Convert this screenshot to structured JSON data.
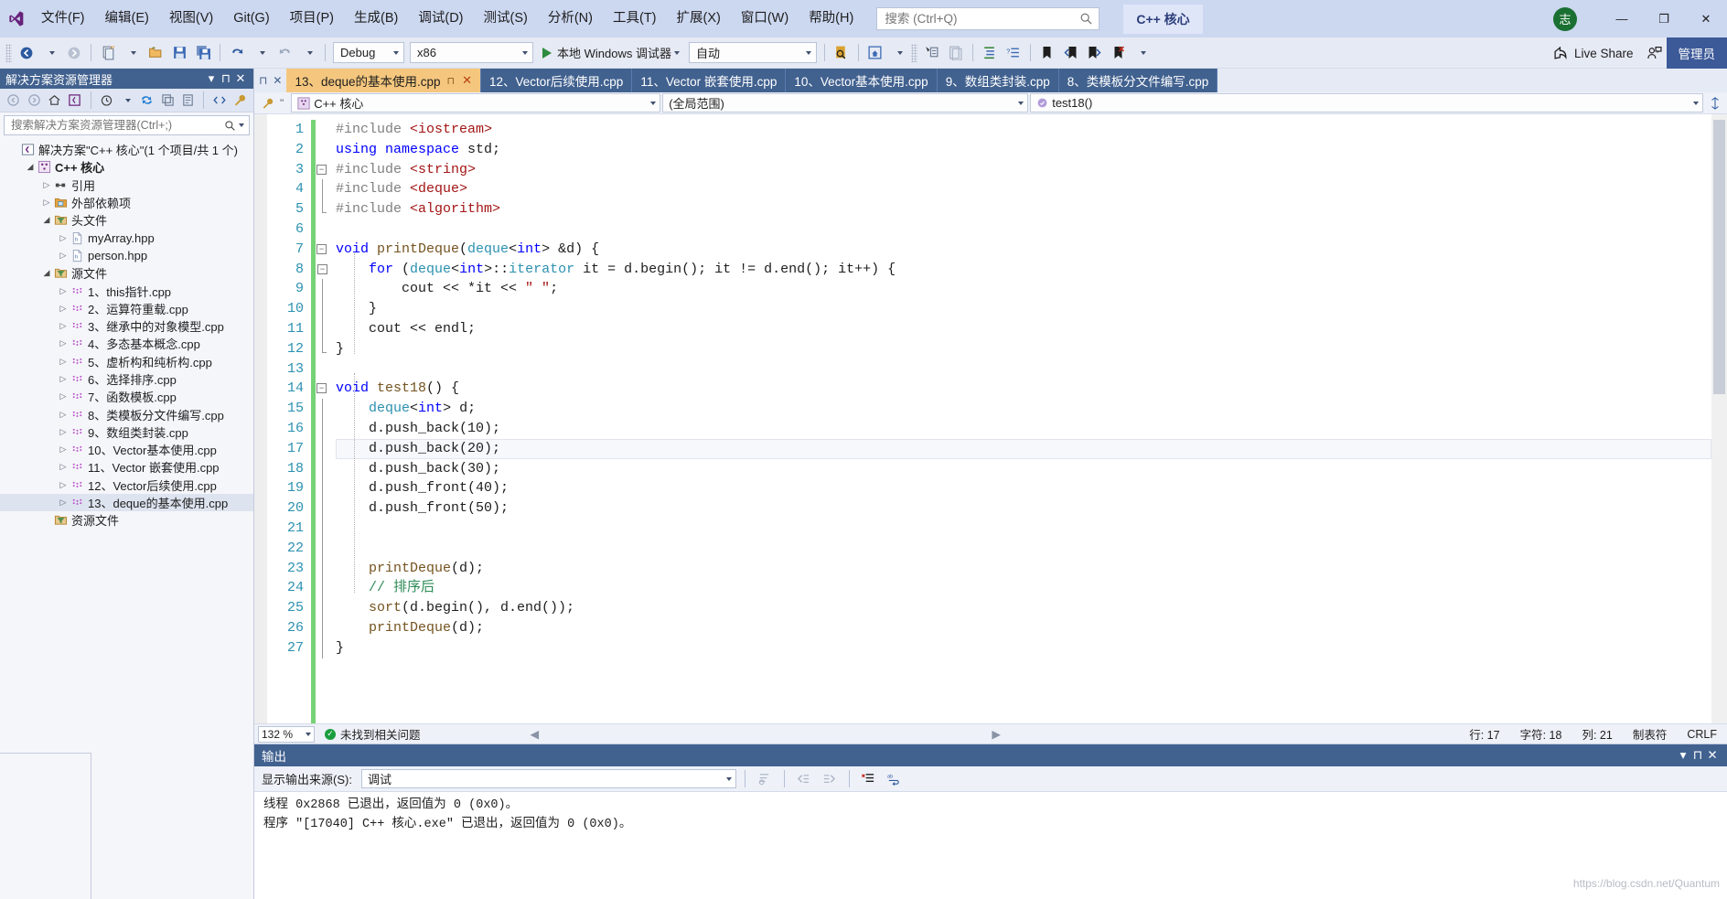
{
  "titlebar": {
    "menu": [
      "文件(F)",
      "编辑(E)",
      "视图(V)",
      "Git(G)",
      "项目(P)",
      "生成(B)",
      "调试(D)",
      "测试(S)",
      "分析(N)",
      "工具(T)",
      "扩展(X)",
      "窗口(W)",
      "帮助(H)"
    ],
    "search_placeholder": "搜索 (Ctrl+Q)",
    "project_badge": "C++ 核心",
    "avatar_text": "志",
    "minimize": "—",
    "maximize": "❐",
    "close": "✕"
  },
  "toolbar": {
    "config": "Debug",
    "platform": "x86",
    "run_label": "本地 Windows 调试器",
    "attach": "自动",
    "live_share": "Live Share",
    "admin": "管理员"
  },
  "solution_explorer": {
    "title": "解决方案资源管理器",
    "search_placeholder": "搜索解决方案资源管理器(Ctrl+;)",
    "tree": [
      {
        "label": "解决方案\"C++ 核心\"(1 个项目/共 1 个)",
        "depth": 0,
        "arrow": "none",
        "icon": "solution-icon",
        "bold": false
      },
      {
        "label": "C++ 核心",
        "depth": 1,
        "arrow": "open",
        "icon": "project-icon",
        "bold": true
      },
      {
        "label": "引用",
        "depth": 2,
        "arrow": "closed",
        "icon": "references-icon",
        "bold": false
      },
      {
        "label": "外部依赖项",
        "depth": 2,
        "arrow": "closed",
        "icon": "folder-ext-icon",
        "bold": false
      },
      {
        "label": "头文件",
        "depth": 2,
        "arrow": "open",
        "icon": "filter-folder-icon",
        "bold": false
      },
      {
        "label": "myArray.hpp",
        "depth": 3,
        "arrow": "closed",
        "icon": "header-file-icon",
        "bold": false
      },
      {
        "label": "person.hpp",
        "depth": 3,
        "arrow": "closed",
        "icon": "header-file-icon",
        "bold": false
      },
      {
        "label": "源文件",
        "depth": 2,
        "arrow": "open",
        "icon": "filter-folder-icon",
        "bold": false
      },
      {
        "label": "1、this指针.cpp",
        "depth": 3,
        "arrow": "closed",
        "icon": "cpp-file-icon",
        "bold": false
      },
      {
        "label": "2、运算符重载.cpp",
        "depth": 3,
        "arrow": "closed",
        "icon": "cpp-file-icon",
        "bold": false
      },
      {
        "label": "3、继承中的对象模型.cpp",
        "depth": 3,
        "arrow": "closed",
        "icon": "cpp-file-icon",
        "bold": false
      },
      {
        "label": "4、多态基本概念.cpp",
        "depth": 3,
        "arrow": "closed",
        "icon": "cpp-file-icon",
        "bold": false
      },
      {
        "label": "5、虚析构和纯析构.cpp",
        "depth": 3,
        "arrow": "closed",
        "icon": "cpp-file-icon",
        "bold": false
      },
      {
        "label": "6、选择排序.cpp",
        "depth": 3,
        "arrow": "closed",
        "icon": "cpp-file-icon",
        "bold": false
      },
      {
        "label": "7、函数模板.cpp",
        "depth": 3,
        "arrow": "closed",
        "icon": "cpp-file-icon",
        "bold": false
      },
      {
        "label": "8、类模板分文件编写.cpp",
        "depth": 3,
        "arrow": "closed",
        "icon": "cpp-file-icon",
        "bold": false
      },
      {
        "label": "9、数组类封装.cpp",
        "depth": 3,
        "arrow": "closed",
        "icon": "cpp-file-icon",
        "bold": false
      },
      {
        "label": "10、Vector基本使用.cpp",
        "depth": 3,
        "arrow": "closed",
        "icon": "cpp-file-icon",
        "bold": false
      },
      {
        "label": "11、Vector 嵌套使用.cpp",
        "depth": 3,
        "arrow": "closed",
        "icon": "cpp-file-icon",
        "bold": false
      },
      {
        "label": "12、Vector后续使用.cpp",
        "depth": 3,
        "arrow": "closed",
        "icon": "cpp-file-icon",
        "bold": false
      },
      {
        "label": "13、deque的基本使用.cpp",
        "depth": 3,
        "arrow": "closed",
        "icon": "cpp-file-icon",
        "bold": false,
        "selected": true
      },
      {
        "label": "资源文件",
        "depth": 2,
        "arrow": "none",
        "icon": "filter-folder-icon",
        "bold": false
      }
    ]
  },
  "tabs": [
    {
      "label": "13、deque的基本使用.cpp",
      "active": true,
      "pin": "⊓",
      "close": "✕"
    },
    {
      "label": "12、Vector后续使用.cpp",
      "active": false
    },
    {
      "label": "11、Vector 嵌套使用.cpp",
      "active": false
    },
    {
      "label": "10、Vector基本使用.cpp",
      "active": false
    },
    {
      "label": "9、数组类封装.cpp",
      "active": false
    },
    {
      "label": "8、类模板分文件编写.cpp",
      "active": false
    }
  ],
  "navbar": {
    "project": "C++ 核心",
    "scope": "(全局范围)",
    "member": "test18()"
  },
  "code": {
    "lines": [
      {
        "n": 1,
        "fold": "none",
        "tokens": [
          {
            "t": "#include ",
            "c": "pp"
          },
          {
            "t": "<iostream>",
            "c": "hdr"
          }
        ]
      },
      {
        "n": 2,
        "fold": "none",
        "tokens": [
          {
            "t": "using namespace ",
            "c": "kw"
          },
          {
            "t": "std;",
            "c": "num"
          }
        ]
      },
      {
        "n": 3,
        "fold": "minus",
        "tokens": [
          {
            "t": "#include ",
            "c": "pp"
          },
          {
            "t": "<string>",
            "c": "hdr"
          }
        ]
      },
      {
        "n": 4,
        "fold": "bar",
        "tokens": [
          {
            "t": "#include ",
            "c": "pp"
          },
          {
            "t": "<deque>",
            "c": "hdr"
          }
        ]
      },
      {
        "n": 5,
        "fold": "barend",
        "tokens": [
          {
            "t": "#include ",
            "c": "pp"
          },
          {
            "t": "<algorithm>",
            "c": "hdr"
          }
        ]
      },
      {
        "n": 6,
        "fold": "none",
        "tokens": []
      },
      {
        "n": 7,
        "fold": "minus",
        "tokens": [
          {
            "t": "void ",
            "c": "kw"
          },
          {
            "t": "printDeque",
            "c": "fn"
          },
          {
            "t": "(",
            "c": "num"
          },
          {
            "t": "deque",
            "c": "ty"
          },
          {
            "t": "<",
            "c": "num"
          },
          {
            "t": "int",
            "c": "kw"
          },
          {
            "t": "> &d) {",
            "c": "num"
          }
        ]
      },
      {
        "n": 8,
        "fold": "minus2",
        "tokens": [
          {
            "t": "    ",
            "c": "num"
          },
          {
            "t": "for",
            "c": "kw"
          },
          {
            "t": " (",
            "c": "num"
          },
          {
            "t": "deque",
            "c": "ty"
          },
          {
            "t": "<",
            "c": "num"
          },
          {
            "t": "int",
            "c": "kw"
          },
          {
            "t": ">::",
            "c": "num"
          },
          {
            "t": "iterator",
            "c": "ty"
          },
          {
            "t": " it = d.begin(); it != d.end(); it++) {",
            "c": "num"
          }
        ]
      },
      {
        "n": 9,
        "fold": "bar2",
        "tokens": [
          {
            "t": "        cout << *it << ",
            "c": "num"
          },
          {
            "t": "\" \"",
            "c": "str"
          },
          {
            "t": ";",
            "c": "num"
          }
        ]
      },
      {
        "n": 10,
        "fold": "bar2",
        "tokens": [
          {
            "t": "    }",
            "c": "num"
          }
        ]
      },
      {
        "n": 11,
        "fold": "bar",
        "tokens": [
          {
            "t": "    cout << endl;",
            "c": "num"
          }
        ]
      },
      {
        "n": 12,
        "fold": "barend",
        "tokens": [
          {
            "t": "}",
            "c": "num"
          }
        ]
      },
      {
        "n": 13,
        "fold": "none",
        "tokens": []
      },
      {
        "n": 14,
        "fold": "minus",
        "tokens": [
          {
            "t": "void ",
            "c": "kw"
          },
          {
            "t": "test18",
            "c": "fn"
          },
          {
            "t": "() {",
            "c": "num"
          }
        ]
      },
      {
        "n": 15,
        "fold": "bar2",
        "tokens": [
          {
            "t": "    ",
            "c": "num"
          },
          {
            "t": "deque",
            "c": "ty"
          },
          {
            "t": "<",
            "c": "num"
          },
          {
            "t": "int",
            "c": "kw"
          },
          {
            "t": "> d;",
            "c": "num"
          }
        ]
      },
      {
        "n": 16,
        "fold": "bar2",
        "tokens": [
          {
            "t": "    d.push_back(10);",
            "c": "num"
          }
        ]
      },
      {
        "n": 17,
        "fold": "bar2",
        "tokens": [
          {
            "t": "    d.push_back(20);",
            "c": "num"
          }
        ],
        "current": true
      },
      {
        "n": 18,
        "fold": "bar2",
        "tokens": [
          {
            "t": "    d.push_back(30);",
            "c": "num"
          }
        ]
      },
      {
        "n": 19,
        "fold": "bar2",
        "tokens": [
          {
            "t": "    d.push_front(40);",
            "c": "num"
          }
        ]
      },
      {
        "n": 20,
        "fold": "bar2",
        "tokens": [
          {
            "t": "    d.push_front(50);",
            "c": "num"
          }
        ]
      },
      {
        "n": 21,
        "fold": "bar2",
        "tokens": []
      },
      {
        "n": 22,
        "fold": "bar2",
        "tokens": []
      },
      {
        "n": 23,
        "fold": "bar2",
        "tokens": [
          {
            "t": "    ",
            "c": "num"
          },
          {
            "t": "printDeque",
            "c": "fn"
          },
          {
            "t": "(d);",
            "c": "num"
          }
        ]
      },
      {
        "n": 24,
        "fold": "bar2",
        "tokens": [
          {
            "t": "    // 排序后",
            "c": "cmt"
          }
        ]
      },
      {
        "n": 25,
        "fold": "bar2",
        "tokens": [
          {
            "t": "    ",
            "c": "num"
          },
          {
            "t": "sort",
            "c": "fn"
          },
          {
            "t": "(d.begin(), d.end());",
            "c": "num"
          }
        ]
      },
      {
        "n": 26,
        "fold": "bar2",
        "tokens": [
          {
            "t": "    ",
            "c": "num"
          },
          {
            "t": "printDeque",
            "c": "fn"
          },
          {
            "t": "(d);",
            "c": "num"
          }
        ]
      },
      {
        "n": 27,
        "fold": "bar2",
        "tokens": [
          {
            "t": "}",
            "c": "num"
          }
        ]
      }
    ]
  },
  "editor_status": {
    "zoom": "132 %",
    "issues": "未找到相关问题",
    "row_label": "行: 17",
    "char_label": "字符: 18",
    "col_label": "列: 21",
    "tabs_label": "制表符",
    "eol": "CRLF"
  },
  "output": {
    "title": "输出",
    "source_label": "显示输出来源(S):",
    "source_value": "调试",
    "lines": [
      "线程 0x2868 已退出，返回值为 0 (0x0)。",
      "程序 \"[17040] C++ 核心.exe\" 已退出，返回值为 0 (0x0)。"
    ],
    "watermark": "https://blog.csdn.net/Quantum"
  }
}
